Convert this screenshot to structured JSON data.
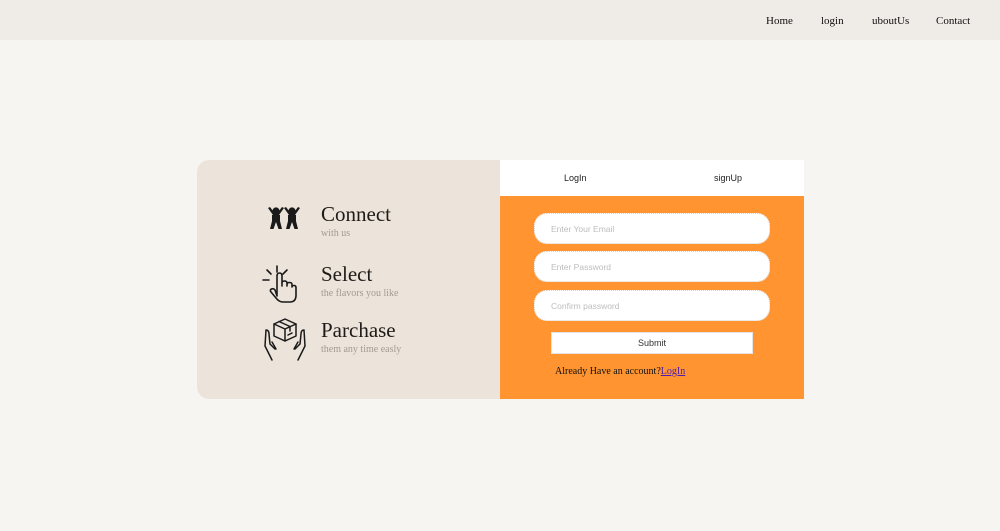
{
  "nav": {
    "home": "Home",
    "login": "login",
    "about": "uboutUs",
    "contact": "Contact"
  },
  "features": [
    {
      "title": "Connect",
      "subtitle": "with us",
      "icon": "people-cheering-icon"
    },
    {
      "title": "Select",
      "subtitle": "the flavors you like",
      "icon": "hand-tap-icon"
    },
    {
      "title": "Parchase",
      "subtitle": "them any time easly",
      "icon": "hands-holding-box-icon"
    }
  ],
  "tabs": {
    "login": "LogIn",
    "signup": "signUp"
  },
  "form": {
    "email_placeholder": "Enter Your Email",
    "password_placeholder": "Enter Password",
    "confirm_placeholder": "Confirm password",
    "submit_label": "Submit",
    "already_text": "Already Have an account?",
    "login_link": "LogIn"
  },
  "colors": {
    "accent": "#ff9430",
    "panel": "#ece4da",
    "background": "#f7f5f1",
    "nav": "#efebe6"
  }
}
